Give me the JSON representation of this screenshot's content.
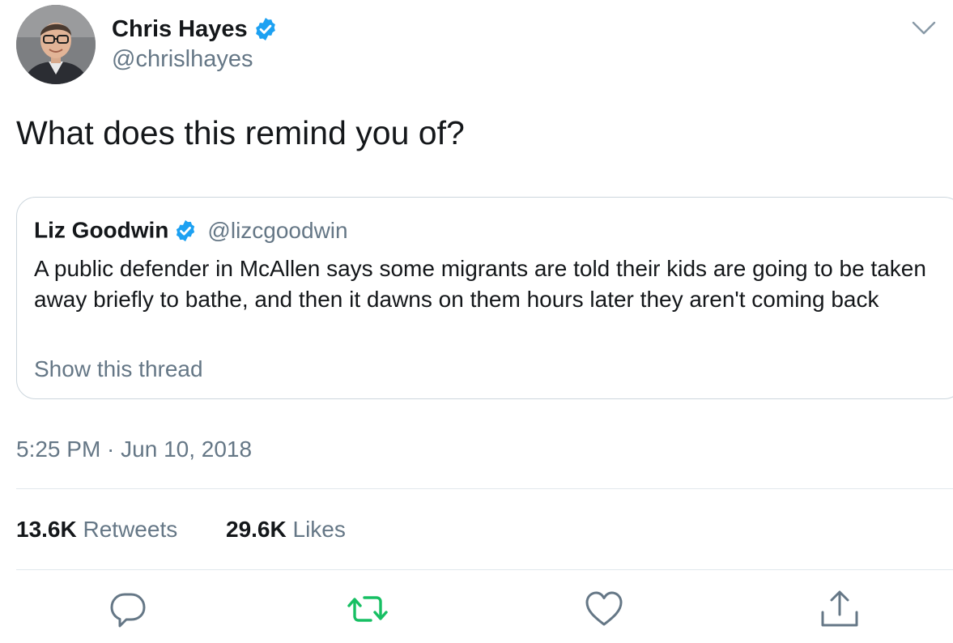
{
  "author": {
    "name": "Chris Hayes",
    "handle": "@chrislhayes",
    "verified": true
  },
  "tweet": {
    "text": "What does this remind you of?",
    "timestamp": "5:25 PM · Jun 10, 2018"
  },
  "quoted_tweet": {
    "name": "Liz Goodwin",
    "handle": "@lizcgoodwin",
    "verified": true,
    "text": "A public defender in McAllen says some migrants are told their kids are going to be taken away briefly to bathe, and then it dawns on them hours later they aren't coming back",
    "show_thread": "Show this thread"
  },
  "stats": {
    "retweets_count": "13.6K",
    "retweets_label": "Retweets",
    "likes_count": "29.6K",
    "likes_label": "Likes"
  },
  "actions": {
    "reply_icon": "reply-icon",
    "retweet_icon": "retweet-icon",
    "like_icon": "heart-icon",
    "share_icon": "share-icon"
  },
  "colors": {
    "verified_blue": "#1da1f2",
    "retweet_green": "#17bf63",
    "secondary_text": "#657786",
    "border": "#ccd6dd"
  }
}
